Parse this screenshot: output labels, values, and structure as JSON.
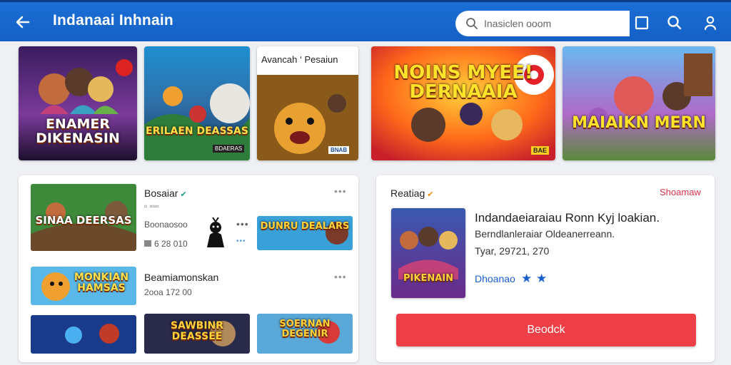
{
  "header": {
    "title": "Indanaai Inhnain",
    "search_placeholder": "Inasiclen ooom",
    "accent": "#1a6fd6"
  },
  "banners": [
    {
      "caption": "ENAMER DIKENASIN"
    },
    {
      "caption": "ERILAEN DEASSAS",
      "badge": "BDAERAS"
    },
    {
      "header": "Avancah ‘ Pesaiun",
      "badge": "BNAB"
    },
    {
      "caption": "NOINS MYEE! DERNAAIA",
      "badge": "BAE"
    },
    {
      "caption": "MAIAIKN MERN"
    }
  ],
  "list_card": {
    "items": [
      {
        "title": "Bosaiar",
        "thumb_caption": "SINAA DEERSAS"
      },
      {
        "meta": "Boonaosoo",
        "thumb_caption": "DUNRU DEALARS"
      },
      {
        "meta": "6 28 010"
      },
      {
        "title": "Beamiamonskan",
        "meta": "2ooa 172 00",
        "thumb_caption": "MONKIAN HAMSAS"
      },
      {
        "thumb_caption": ""
      },
      {
        "thumb_caption": "SAWBINR DEASSEE"
      },
      {
        "thumb_caption": "SOERNAN DEGENIR"
      }
    ]
  },
  "detail_card": {
    "heading": "Reatiag",
    "show_all": "Shoamaw",
    "title": "Indandaeiaraiau Ronn Kyj loakian.",
    "subtitle": "Berndlanleraiar Oldeanerreann.",
    "year": "Tyar, 29721, 270",
    "link": "Dhoanao",
    "poster_caption": "PIKENAIN",
    "cta": "Beodck"
  }
}
